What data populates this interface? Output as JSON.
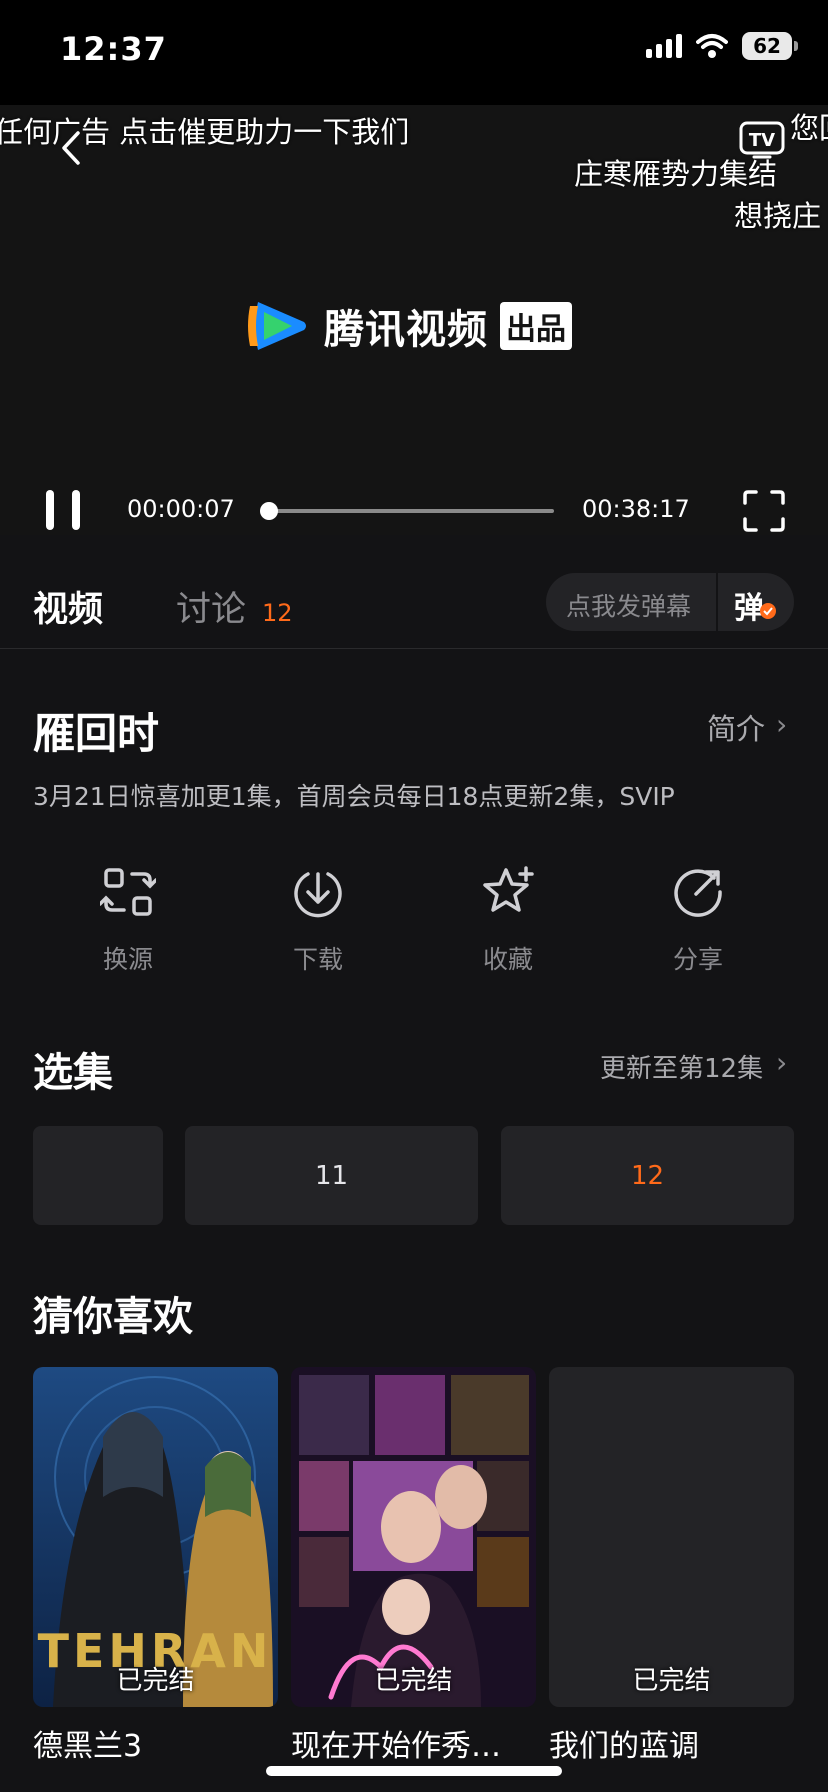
{
  "status_bar": {
    "time": "12:37",
    "battery": "62"
  },
  "player": {
    "danmu": [
      "任何广告 点击催更助力一下我们",
      "您回",
      "庄寒雁势力集结",
      "想挠庄"
    ],
    "logo_text": "腾讯视频",
    "logo_badge": "出品",
    "current_time": "00:00:07",
    "total_time": "00:38:17",
    "progress_fraction": 0.003
  },
  "tabs": {
    "video": "视频",
    "discuss": "讨论",
    "discuss_count": "12",
    "danmu_placeholder": "点我发弹幕",
    "danmu_icon": "弹"
  },
  "show": {
    "title": "雁回时",
    "intro_link": "简介",
    "update_notice": "3月21日惊喜加更1集，首周会员每日18点更新2集，SVIP"
  },
  "actions": [
    {
      "label": "换源",
      "icon": "switch-source-icon"
    },
    {
      "label": "下载",
      "icon": "download-icon"
    },
    {
      "label": "收藏",
      "icon": "favorite-star-icon"
    },
    {
      "label": "分享",
      "icon": "share-icon"
    }
  ],
  "episodes": {
    "title": "选集",
    "update_info": "更新至第12集",
    "items": [
      "11",
      "12"
    ],
    "current": "12"
  },
  "recommend": {
    "title": "猜你喜欢",
    "items": [
      {
        "title": "德黑兰3",
        "badge": "已完结",
        "poster_text": "TEHRAN"
      },
      {
        "title": "现在开始作秀…",
        "badge": "已完结"
      },
      {
        "title": "我们的蓝调",
        "badge": "已完结"
      }
    ]
  },
  "colors": {
    "accent": "#ff6a1a",
    "background": "#131315",
    "card": "#232326"
  }
}
